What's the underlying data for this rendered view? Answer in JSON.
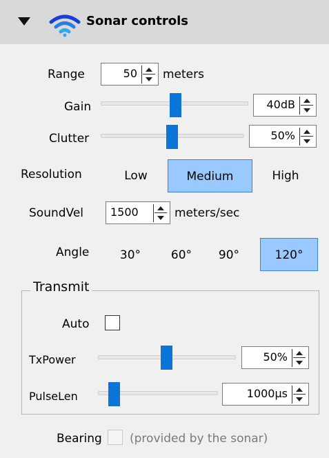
{
  "header": {
    "title": "Sonar controls",
    "icons": [
      "chevron-down-icon",
      "wifi-icon"
    ],
    "accent": "#1a73e8"
  },
  "range": {
    "label": "Range",
    "value": "50",
    "unit": "meters"
  },
  "gain": {
    "label": "Gain",
    "value": "40dB",
    "level": 0.47
  },
  "clutter": {
    "label": "Clutter",
    "value": "50%",
    "level": 0.48
  },
  "resolution": {
    "label": "Resolution",
    "options": [
      "Low",
      "Medium",
      "High"
    ],
    "selected": "Medium"
  },
  "soundvel": {
    "label": "SoundVel",
    "value": "1500",
    "unit": "meters/sec"
  },
  "angle": {
    "label": "Angle",
    "options": [
      "30°",
      "60°",
      "90°",
      "120°"
    ],
    "selected": "120°"
  },
  "transmit": {
    "title": "Transmit",
    "auto": {
      "label": "Auto",
      "checked": false
    },
    "txpower": {
      "label": "TxPower",
      "value": "50%",
      "level": 0.5
    },
    "pulselen": {
      "label": "PulseLen",
      "value": "1000μs",
      "level": 0.06
    }
  },
  "bearing": {
    "label": "Bearing",
    "note": "(provided by the sonar)",
    "checked": false,
    "enabled": false
  },
  "colors": {
    "selected_bg": "#99c9ff",
    "thumb": "#0a74d9",
    "panel": "#f0f0f0",
    "header_bg": "#d9d9d9"
  }
}
